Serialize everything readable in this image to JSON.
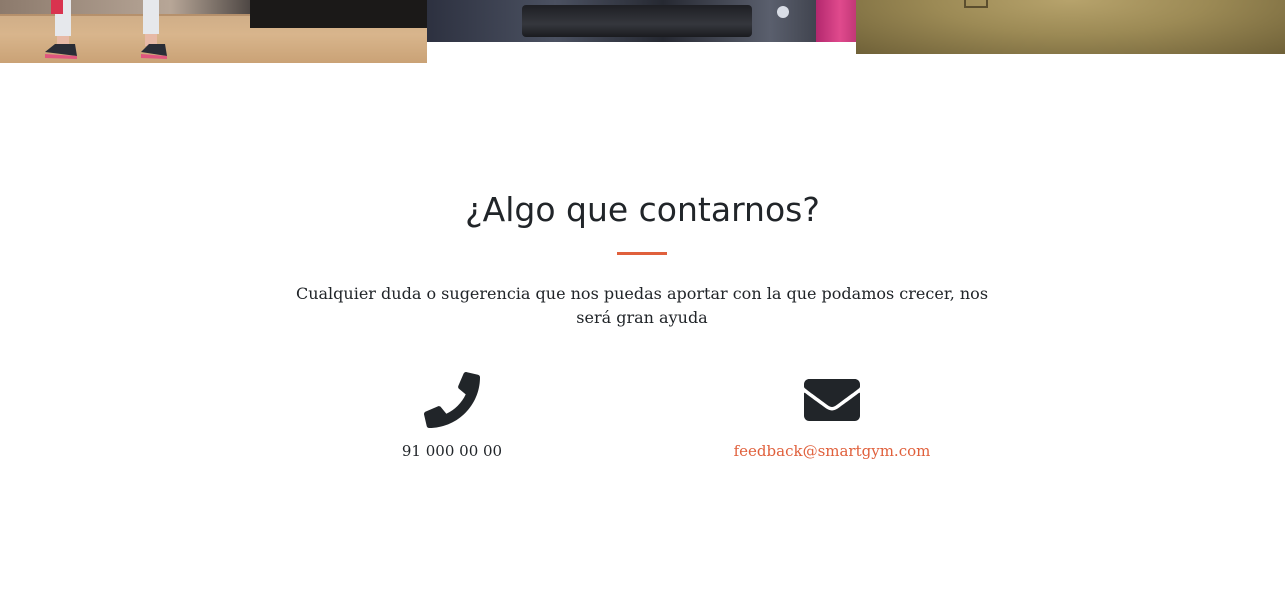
{
  "gallery": {
    "photos": [
      {
        "icon": "fitness-class-photo"
      },
      {
        "icon": "gym-equipment-photo"
      },
      {
        "icon": "gym-floor-photo"
      }
    ]
  },
  "contact": {
    "title": "¿Algo que contarnos?",
    "lead": "Cualquier duda o sugerencia que nos puedas aportar con la que podamos crecer, nos será gran ayuda",
    "accent_color": "#e0603c",
    "phone": {
      "icon": "phone-icon",
      "value": "91 000 00 00"
    },
    "email": {
      "icon": "envelope-icon",
      "value": "feedback@smartgym.com"
    }
  }
}
